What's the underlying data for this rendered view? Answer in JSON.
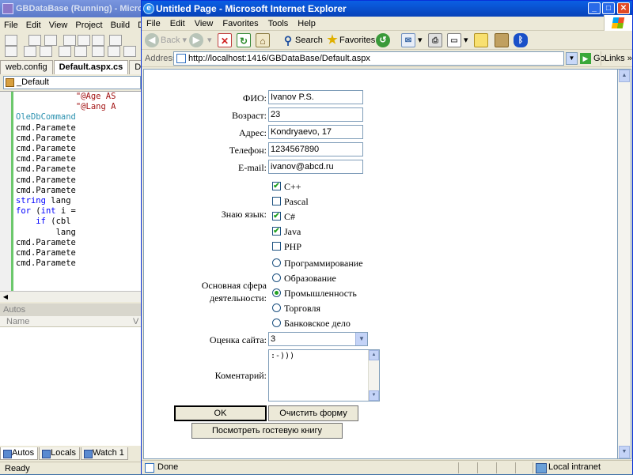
{
  "vs": {
    "title": "GBDataBase (Running) - Microsoft Vi",
    "menu": [
      "File",
      "Edit",
      "View",
      "Project",
      "Build",
      "Deb"
    ],
    "tabs": [
      "web.config",
      "Default.aspx.cs",
      "Default.aspx"
    ],
    "combo": "_Default",
    "code": [
      {
        "text": "\"@Age AS",
        "cls": "code-str",
        "indent": 12
      },
      {
        "text": "\"@Lang A",
        "cls": "code-str",
        "indent": 12
      },
      {
        "text": "OleDbCommand",
        "cls": "code-type",
        "indent": 0
      },
      {
        "text": "cmd.Paramete",
        "cls": "",
        "indent": 0
      },
      {
        "text": "cmd.Paramete",
        "cls": "",
        "indent": 0
      },
      {
        "text": "cmd.Paramete",
        "cls": "",
        "indent": 0
      },
      {
        "text": "cmd.Paramete",
        "cls": "",
        "indent": 0
      },
      {
        "text": "cmd.Paramete",
        "cls": "",
        "indent": 0
      },
      {
        "text": "cmd.Paramete",
        "cls": "",
        "indent": 0
      },
      {
        "text": "cmd.Paramete",
        "cls": "",
        "indent": 0
      },
      {
        "text": "string lang",
        "cls": "mix-string",
        "indent": 0
      },
      {
        "text": "for (int i =",
        "cls": "mix-for",
        "indent": 0
      },
      {
        "text": "if (cbl",
        "cls": "mix-if",
        "indent": 4
      },
      {
        "text": "lang",
        "cls": "",
        "indent": 8
      },
      {
        "text": "cmd.Paramete",
        "cls": "",
        "indent": 0
      },
      {
        "text": "cmd.Paramete",
        "cls": "",
        "indent": 0
      },
      {
        "text": "cmd.Paramete",
        "cls": "",
        "indent": 0
      }
    ],
    "autos_title": "Autos",
    "autos_col": "Name",
    "autos_col2": "V",
    "bottom_tabs": [
      "Autos",
      "Locals",
      "Watch 1"
    ],
    "status": "Ready"
  },
  "ie": {
    "title": "Untitled Page - Microsoft Internet Explorer",
    "menu": [
      "File",
      "Edit",
      "View",
      "Favorites",
      "Tools",
      "Help"
    ],
    "toolbar": {
      "back": "Back",
      "search": "Search",
      "favorites": "Favorites"
    },
    "address_label": "Address",
    "url": "http://localhost:1416/GBDataBase/Default.aspx",
    "go": "Go",
    "links": "Links",
    "status_done": "Done",
    "status_zone": "Local intranet"
  },
  "form": {
    "fio": {
      "label": "ФИО:",
      "value": "Ivanov P.S."
    },
    "age": {
      "label": "Возраст:",
      "value": "23"
    },
    "address": {
      "label": "Адрес:",
      "value": "Kondryaevo, 17"
    },
    "phone": {
      "label": "Телефон:",
      "value": "1234567890"
    },
    "email": {
      "label": "E-mail:",
      "value": "ivanov@abcd.ru"
    },
    "languages_label": "Знаю язык:",
    "languages": [
      {
        "name": "C++",
        "checked": true
      },
      {
        "name": "Pascal",
        "checked": false
      },
      {
        "name": "C#",
        "checked": true
      },
      {
        "name": "Java",
        "checked": true
      },
      {
        "name": "PHP",
        "checked": false
      }
    ],
    "sphere_label_1": "Основная сфера",
    "sphere_label_2": "деятельности:",
    "spheres": [
      {
        "name": "Программирование",
        "selected": false
      },
      {
        "name": "Образование",
        "selected": false
      },
      {
        "name": "Промышленность",
        "selected": true
      },
      {
        "name": "Торговля",
        "selected": false
      },
      {
        "name": "Банковское дело",
        "selected": false
      }
    ],
    "rating": {
      "label": "Оценка сайта:",
      "value": "3"
    },
    "comment": {
      "label": "Коментарий:",
      "value": ":-)))"
    },
    "ok_label": "OK",
    "clear_label": "Очистить форму",
    "guestbook_label": "Посмотреть гостевую книгу"
  }
}
